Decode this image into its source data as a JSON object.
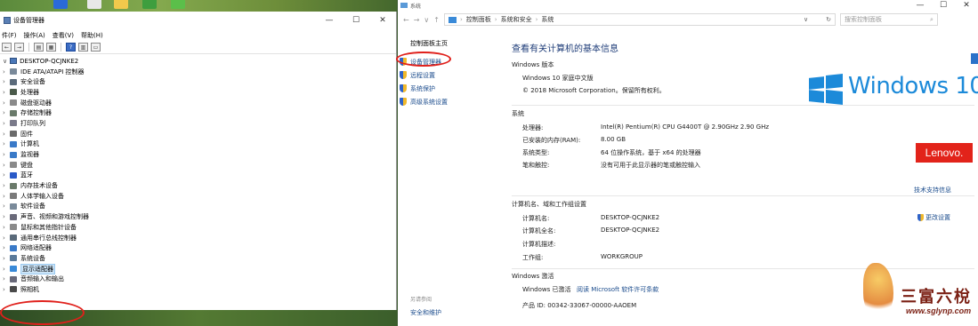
{
  "device_manager": {
    "title": "设备管理器",
    "menu": [
      "件(F)",
      "操作(A)",
      "查看(V)",
      "帮助(H)"
    ],
    "computer_name": "DESKTOP-QCJNKE2",
    "categories": [
      {
        "label": "IDE ATA/ATAPI 控制器",
        "color": "#7a8a9a"
      },
      {
        "label": "安全设备",
        "color": "#5a6a7a"
      },
      {
        "label": "处理器",
        "color": "#4a5a4a"
      },
      {
        "label": "磁盘驱动器",
        "color": "#8a8a8a"
      },
      {
        "label": "存储控制器",
        "color": "#6a7a6a"
      },
      {
        "label": "打印队列",
        "color": "#7a7a8a"
      },
      {
        "label": "固件",
        "color": "#6a6a6a"
      },
      {
        "label": "计算机",
        "color": "#3a7ac8"
      },
      {
        "label": "监视器",
        "color": "#3a7ac8"
      },
      {
        "label": "键盘",
        "color": "#8a8a8a"
      },
      {
        "label": "蓝牙",
        "color": "#2a5ac8"
      },
      {
        "label": "内存技术设备",
        "color": "#6a7a6a"
      },
      {
        "label": "人体学输入设备",
        "color": "#7a7a7a"
      },
      {
        "label": "软件设备",
        "color": "#7a8a9a"
      },
      {
        "label": "声音、视频和游戏控制器",
        "color": "#6a6a7a"
      },
      {
        "label": "鼠标和其他指针设备",
        "color": "#8a8a8a"
      },
      {
        "label": "通用串行总线控制器",
        "color": "#5a6a7a"
      },
      {
        "label": "网络适配器",
        "color": "#3a7ac8"
      },
      {
        "label": "系统设备",
        "color": "#5a7a9a"
      },
      {
        "label": "显示适配器",
        "color": "#3a8ad8"
      },
      {
        "label": "音频输入和输出",
        "color": "#6a6a7a"
      },
      {
        "label": "照相机",
        "color": "#4a4a4a"
      }
    ]
  },
  "system": {
    "window_title": "系统",
    "breadcrumb": [
      "控制面板",
      "系统和安全",
      "系统"
    ],
    "search_placeholder": "搜索控制面板",
    "left_home": "控制面板主页",
    "left_links": [
      "设备管理器",
      "远程设置",
      "系统保护",
      "高级系统设置"
    ],
    "see_also": "另请参阅",
    "security_link": "安全和维护",
    "heading": "查看有关计算机的基本信息",
    "edition_section": "Windows 版本",
    "edition": "Windows 10 家庭中文版",
    "copyright": "© 2018 Microsoft Corporation。保留所有权利。",
    "windows_logo_text": "Windows 10",
    "lenovo_logo": "Lenovo.",
    "system_section": "系统",
    "system_rows": [
      {
        "label": "处理器:",
        "value": "Intel(R) Pentium(R) CPU G4400T @ 2.90GHz   2.90 GHz"
      },
      {
        "label": "已安装的内存(RAM):",
        "value": "8.00 GB"
      },
      {
        "label": "系统类型:",
        "value": "64 位操作系统，基于 x64 的处理器"
      },
      {
        "label": "笔和触控:",
        "value": "没有可用于此显示器的笔或触控输入"
      }
    ],
    "support_link": "技术支持信息",
    "name_section": "计算机名、域和工作组设置",
    "name_rows": [
      {
        "label": "计算机名:",
        "value": "DESKTOP-QCJNKE2"
      },
      {
        "label": "计算机全名:",
        "value": "DESKTOP-QCJNKE2"
      },
      {
        "label": "计算机描述:",
        "value": ""
      },
      {
        "label": "工作组:",
        "value": "WORKGROUP"
      }
    ],
    "change_settings": "更改设置",
    "activation_section": "Windows 激活",
    "activation_status": "Windows 已激活",
    "license_link": "阅读 Microsoft 软件许可条款",
    "product_id": "产品 ID: 00342-33067-00000-AAOEM"
  },
  "watermark": {
    "text": "三富六梲",
    "url": "www.sglynp.com"
  },
  "colors": {
    "accent": "#1c8ad9",
    "link": "#1a4b8c",
    "highlight": "#e0201b",
    "lenovo": "#e2231a"
  }
}
